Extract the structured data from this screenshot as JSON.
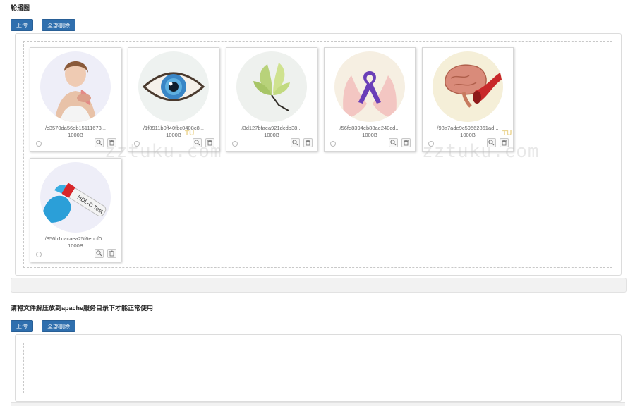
{
  "section1": {
    "title": "轮播图",
    "upload_label": "上传",
    "delete_all_label": "全部删除",
    "files": [
      {
        "name": "/c3570da56db15111673...",
        "size": "1000B",
        "image": "woman-chest-pain"
      },
      {
        "name": "/1f8911b0ff40fbc0408c8...",
        "size": "1000B",
        "image": "eye"
      },
      {
        "name": "/3d127bfaea921dcdb38...",
        "size": "1000B",
        "image": "magnolia-flower"
      },
      {
        "name": "/56fd8394eb88ae240cd...",
        "size": "1000B",
        "image": "hands-ribbon"
      },
      {
        "name": "/98a7ade9c59562861ad...",
        "size": "1000B",
        "image": "brain-artery"
      },
      {
        "name": "/856b1cacaea25f6ebbf0...",
        "size": "1000B",
        "image": "blood-test-tube"
      }
    ]
  },
  "section2": {
    "title": "请将文件解压放到apache服务目录下才能正常使用",
    "upload_label": "上传",
    "delete_all_label": "全部删除"
  },
  "watermark": {
    "text": "zztuku.com",
    "badge": "TU"
  },
  "colors": {
    "button": "#2f6fae",
    "border": "#dcdcdc"
  }
}
